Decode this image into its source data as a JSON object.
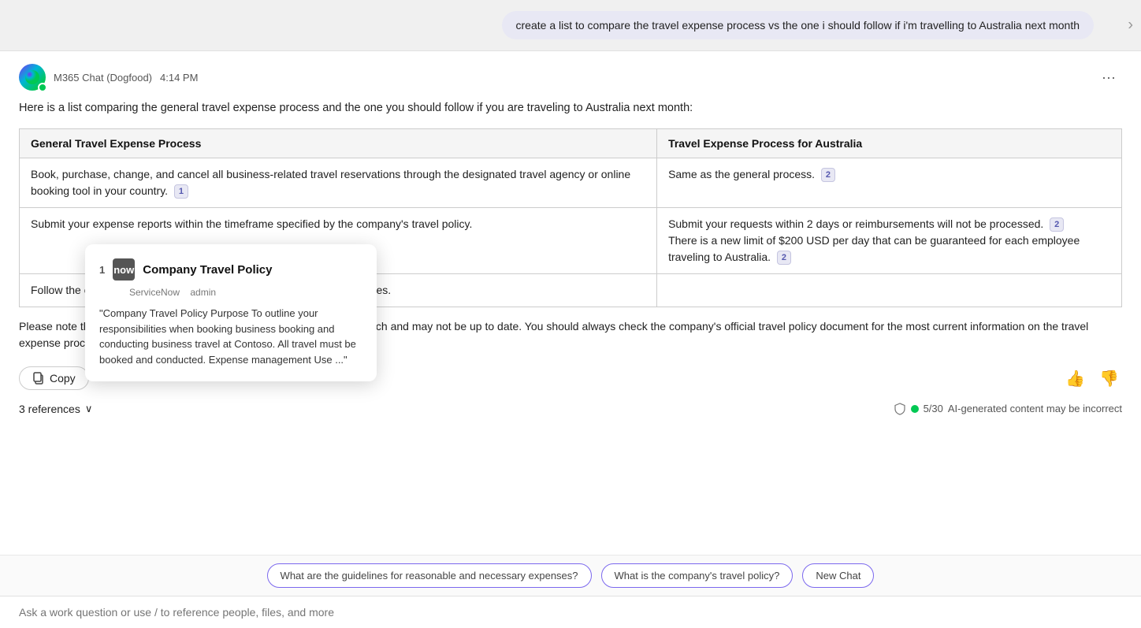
{
  "header": {
    "user_message": "create a list to compare the travel expense process vs the one i should follow if i'm travelling to Australia next month"
  },
  "ai_header": {
    "app_name": "M365 Chat (Dogfood)",
    "timestamp": "4:14 PM",
    "more_icon": "···"
  },
  "ai_message": {
    "intro": "Here is a list comparing the general travel expense process and the one you should follow if you are traveling to Australia next month:",
    "table": {
      "col1_header": "General Travel Expense Process",
      "col2_header": "Travel Expense Process for Australia",
      "rows": [
        {
          "col1": "Book, purchase, change, and cancel all business-related travel reservations through the designated travel agency or online booking tool in your country.",
          "col1_ref": "1",
          "col2": "Same as the general process.",
          "col2_ref": "2"
        },
        {
          "col1": "Submit your expense reports within the timeframe specified by the company's travel policy.",
          "col1_ref": "",
          "col2": "Submit your requests within 2 days or reimbursements will not be processed. 2\nThere is a new limit of $200 USD per day that can be guaranteed for each employee traveling to Australia.",
          "col2_ref": "2"
        },
        {
          "col1": "Follow the company's guidelines for reasonable and necessary expenses.",
          "col1_ref": "",
          "col2": "",
          "col2_ref": ""
        }
      ]
    },
    "disclaimer": "Please note that the above information is based on the results of my search and may not be up to date. You should always check the company's official travel policy document for the most current information on the travel expense process. Is there anything else I can help you with?",
    "copy_label": "Copy",
    "references_label": "3 references",
    "safety_label": "5/30",
    "ai_generated_label": "AI-generated content may be incorrect"
  },
  "tooltip": {
    "ref_num": "1",
    "icon_text": "now",
    "title": "Company Travel Policy",
    "source": "ServiceNow",
    "source_role": "admin",
    "excerpt": "\"Company Travel Policy Purpose To outline your responsibilities when booking business booking and conducting business travel at Contoso. All travel must be booked and conducted. Expense management Use ...\""
  },
  "suggestions": [
    "What are the guidelines for reasonable and necessary expenses?",
    "What is the company's travel policy?",
    "New Chat"
  ],
  "input": {
    "placeholder": "Ask a work question or use / to reference people, files, and more"
  }
}
